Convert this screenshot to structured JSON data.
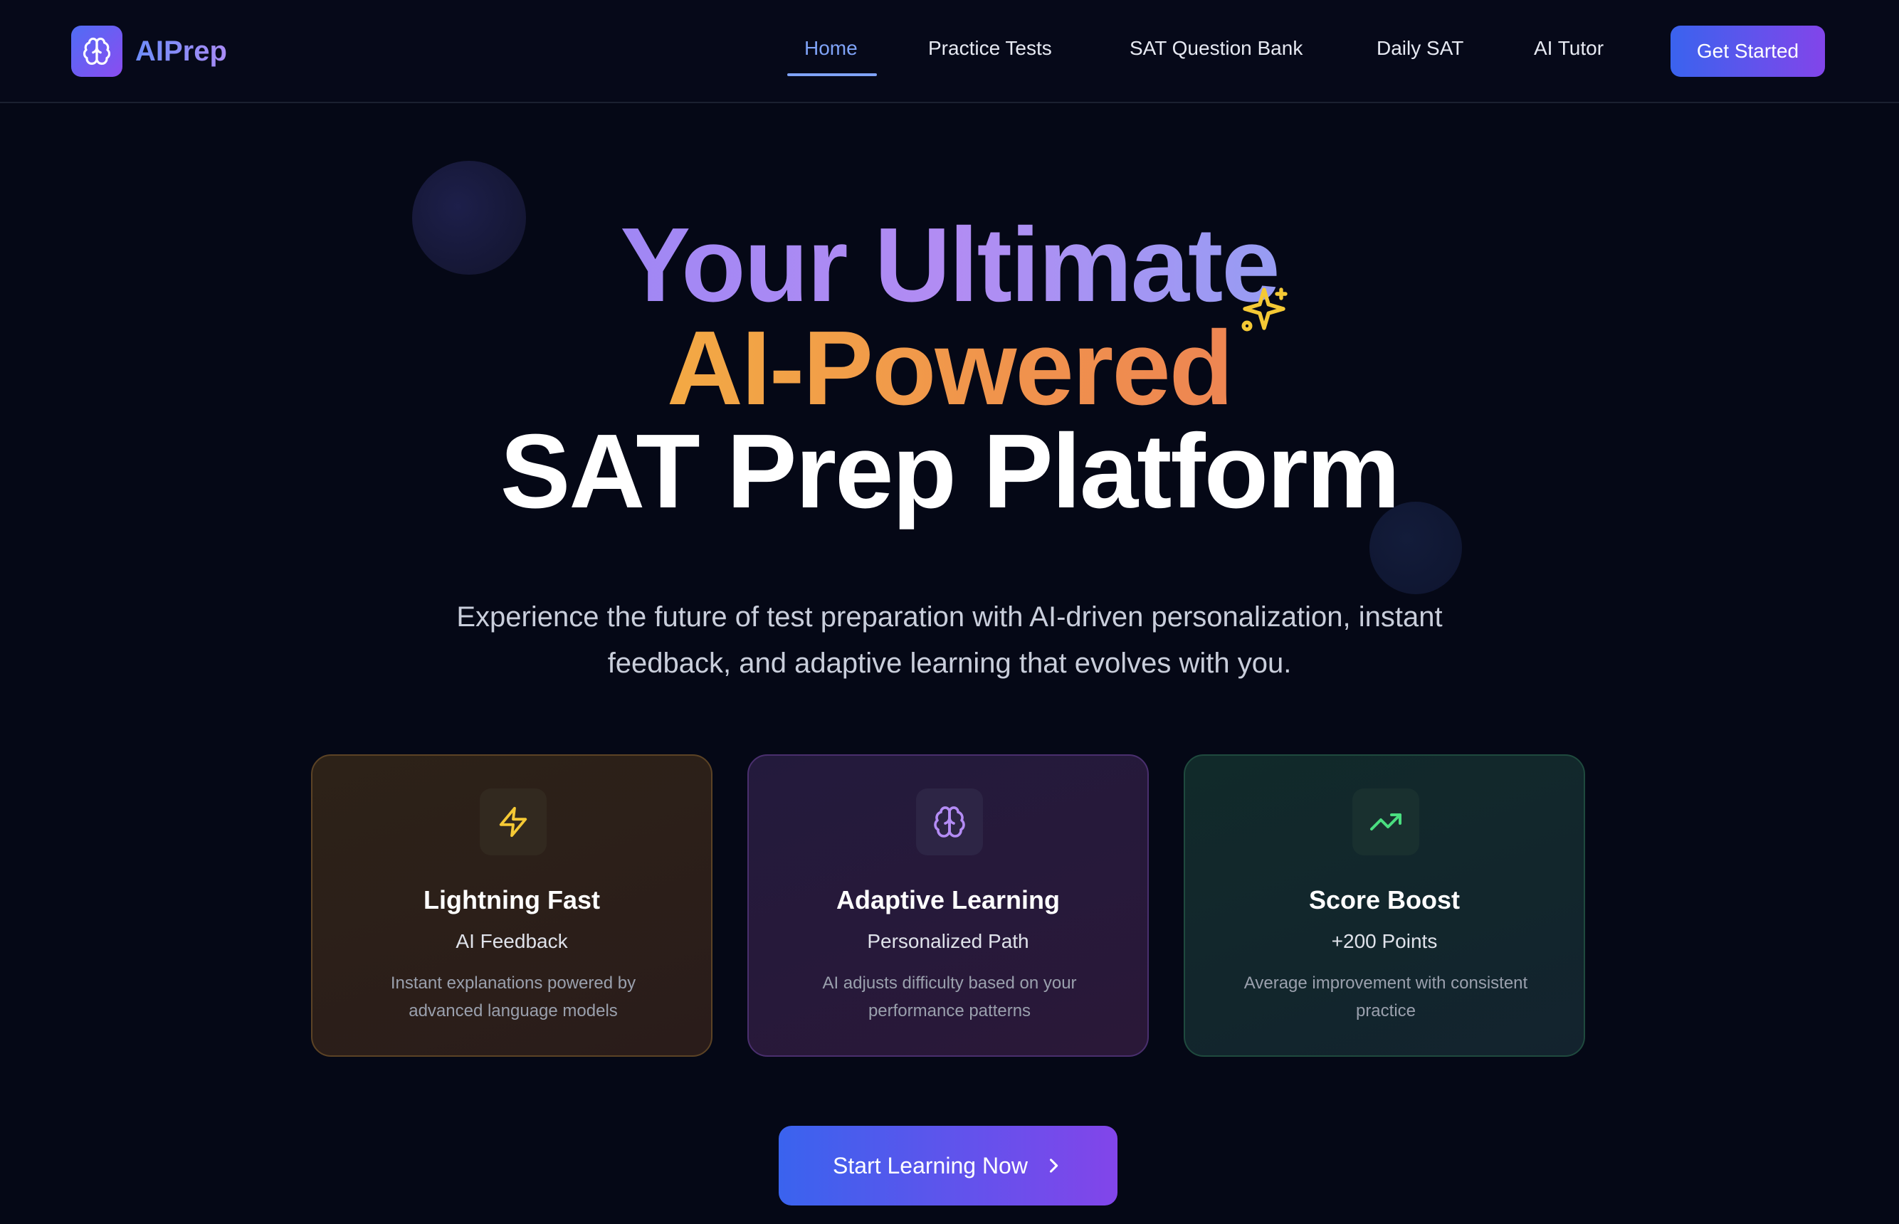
{
  "nav": {
    "brand": "AIPrep",
    "links": [
      {
        "label": "Home",
        "active": true
      },
      {
        "label": "Practice Tests",
        "active": false
      },
      {
        "label": "SAT Question Bank",
        "active": false
      },
      {
        "label": "Daily SAT",
        "active": false
      },
      {
        "label": "AI Tutor",
        "active": false
      }
    ],
    "cta_label": "Get Started"
  },
  "hero": {
    "title_line1": "Your Ultimate",
    "title_line2": "AI-Powered",
    "title_line3": "SAT Prep Platform",
    "subtitle_line1": "Experience the future of test preparation with AI-driven personalization, instant",
    "subtitle_line2": "feedback, and adaptive learning that evolves with you."
  },
  "features": [
    {
      "icon": "lightning-icon",
      "title": "Lightning Fast",
      "subtitle": "AI Feedback",
      "description": "Instant explanations powered by advanced language models",
      "accent": "#f5c935"
    },
    {
      "icon": "brain-icon",
      "title": "Adaptive Learning",
      "subtitle": "Personalized Path",
      "description": "AI adjusts difficulty based on your performance patterns",
      "accent": "#b48cf5"
    },
    {
      "icon": "trending-up-icon",
      "title": "Score Boost",
      "subtitle": "+200 Points",
      "description": "Average improvement with consistent practice",
      "accent": "#4ade80"
    }
  ],
  "cta": {
    "label": "Start Learning Now"
  },
  "colors": {
    "background": "#050816",
    "primary_gradient_start": "#3a63ee",
    "primary_gradient_end": "#8245ea",
    "active_nav": "#7fa3f7"
  }
}
